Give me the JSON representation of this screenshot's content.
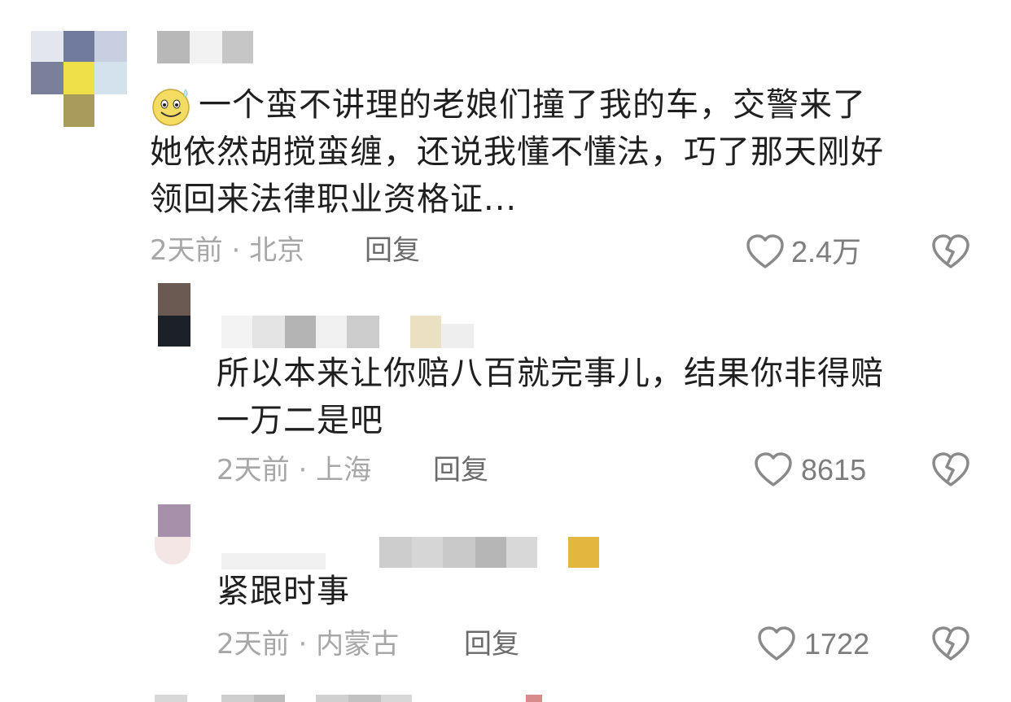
{
  "comments": [
    {
      "emoji": "smile-sweat-emoji",
      "text_line1": "一个蛮不讲理的老娘们撞了我的车，交警来了",
      "text_line2": "她依然胡搅蛮缠，还说我懂不懂法，巧了那天刚好",
      "text_line3": "领回来法律职业资格证...",
      "time": "2天前",
      "separator": "·",
      "location": "北京",
      "reply_label": "回复",
      "likes": "2.4万"
    },
    {
      "text_line1": "所以本来让你赔八百就完事儿，结果你非得赔",
      "text_line2": "一万二是吧",
      "time": "2天前",
      "separator": "·",
      "location": "上海",
      "reply_label": "回复",
      "likes": "8615"
    },
    {
      "text_line1": "紧跟时事",
      "time": "2天前",
      "separator": "·",
      "location": "内蒙古",
      "reply_label": "回复",
      "likes": "1722"
    }
  ],
  "icons": {
    "like": "heart-outline-icon",
    "dislike": "broken-heart-icon"
  },
  "colors": {
    "text": "#1f1f1f",
    "meta": "#a7a7a7",
    "reply": "#6b6b6b",
    "icon": "#8a8a8a"
  }
}
